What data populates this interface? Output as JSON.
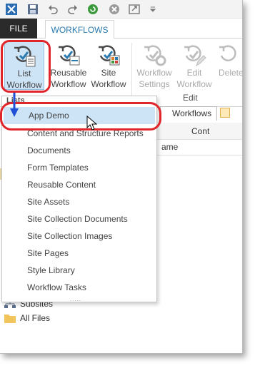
{
  "ribbon": {
    "tabs": {
      "file": "FILE",
      "workflows": "WORKFLOWS"
    },
    "buttons": {
      "list_workflow": {
        "line1": "List",
        "line2": "Workflow"
      },
      "reusable_workflow": {
        "line1": "Reusable",
        "line2": "Workflow"
      },
      "site_workflow": {
        "line1": "Site",
        "line2": "Workflow"
      },
      "workflow_settings": {
        "line1": "Workflow",
        "line2": "Settings"
      },
      "edit_workflow": {
        "line1": "Edit",
        "line2": "Workflow"
      },
      "delete": {
        "line1": "Delete"
      }
    },
    "groups": {
      "edit": "Edit"
    }
  },
  "menu": {
    "header": "Lists",
    "items": [
      "App Demo",
      "Content and Structure Reports",
      "Documents",
      "Form Templates",
      "Reusable Content",
      "Site Assets",
      "Site Collection Documents",
      "Site Collection Images",
      "Site Pages",
      "Style Library",
      "Workflow Tasks"
    ],
    "grip": "....."
  },
  "background": {
    "tab_label": "Workflows",
    "address_text": "Cont",
    "column_header": "ame",
    "nav": [
      "Subsites",
      "All Files"
    ]
  },
  "colors": {
    "annotation": "#e0252b",
    "accent": "#2a7ab0",
    "highlight": "#cde4f7"
  }
}
